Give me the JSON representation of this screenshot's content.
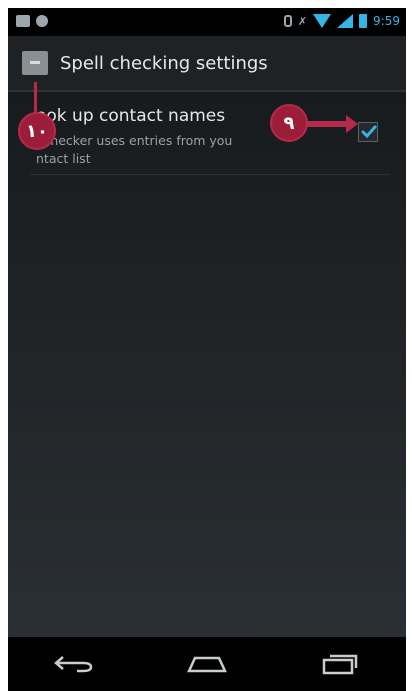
{
  "status_bar": {
    "time": "9:59",
    "icons": [
      "message-icon",
      "android-icon",
      "vibrate-icon",
      "mute-icon",
      "wifi-icon",
      "signal-icon",
      "battery-icon"
    ]
  },
  "action_bar": {
    "title": "Spell checking settings",
    "icon": "keyboard-icon"
  },
  "preference": {
    "title": "ook up contact names",
    "summary_line1": "l checker uses entries from you",
    "summary_line2": "ntact list",
    "checked": true
  },
  "callouts": [
    {
      "label": "١٠"
    },
    {
      "label": "٩"
    }
  ],
  "nav_bar": {
    "buttons": [
      "back-icon",
      "home-icon",
      "recent-apps-icon"
    ]
  },
  "colors": {
    "accent": "#33b5e5",
    "callout": "#9c1d3a"
  }
}
